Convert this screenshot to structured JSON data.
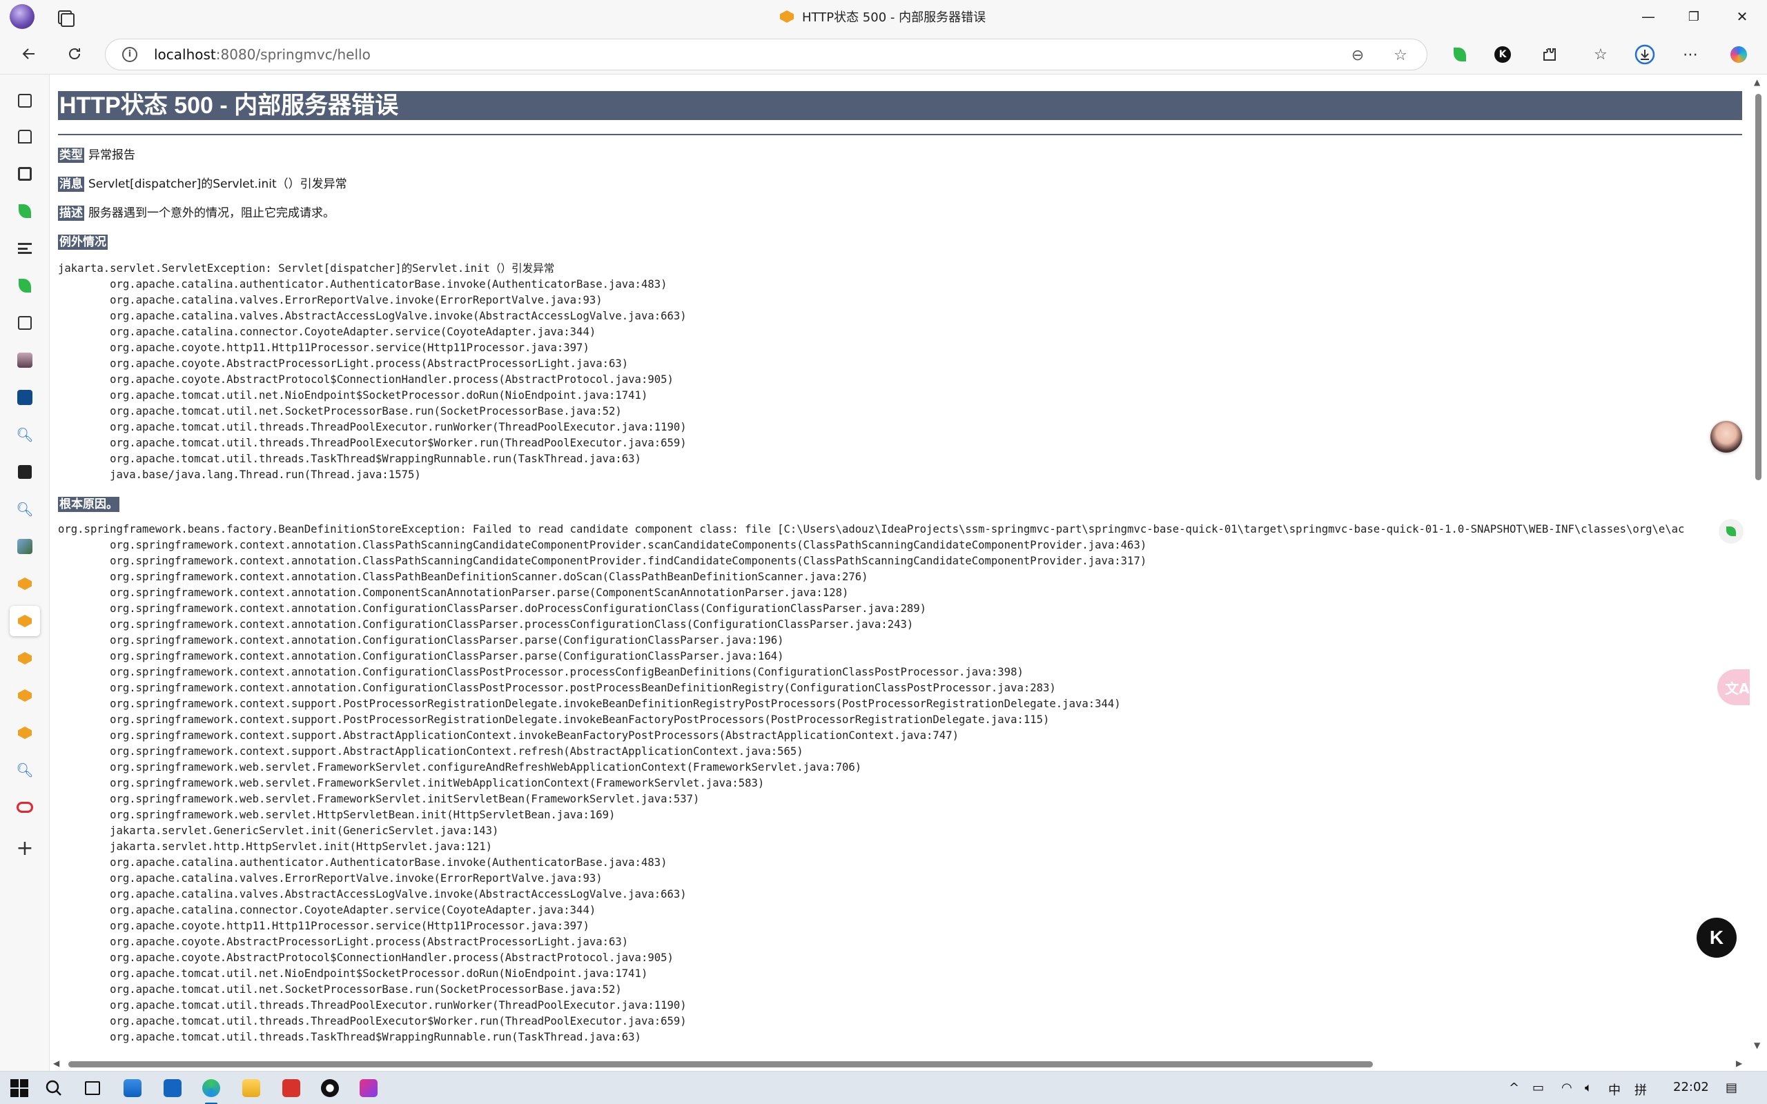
{
  "window": {
    "title": "HTTP状态 500 - 内部服务器错误",
    "minimize": "—",
    "maximize": "❐",
    "close": "✕"
  },
  "address": {
    "host": "localhost",
    "path": ":8080/springmvc/hello"
  },
  "page": {
    "heading": "HTTP状态 500 - 内部服务器错误",
    "type_label": "类型",
    "type_value": "异常报告",
    "message_label": "消息",
    "message_value": "Servlet[dispatcher]的Servlet.init（）引发异常",
    "description_label": "描述",
    "description_value": "服务器遇到一个意外的情况，阻止它完成请求。",
    "exception_label": "例外情况",
    "exception_trace": "jakarta.servlet.ServletException: Servlet[dispatcher]的Servlet.init（）引发异常\n\torg.apache.catalina.authenticator.AuthenticatorBase.invoke(AuthenticatorBase.java:483)\n\torg.apache.catalina.valves.ErrorReportValve.invoke(ErrorReportValve.java:93)\n\torg.apache.catalina.valves.AbstractAccessLogValve.invoke(AbstractAccessLogValve.java:663)\n\torg.apache.catalina.connector.CoyoteAdapter.service(CoyoteAdapter.java:344)\n\torg.apache.coyote.http11.Http11Processor.service(Http11Processor.java:397)\n\torg.apache.coyote.AbstractProcessorLight.process(AbstractProcessorLight.java:63)\n\torg.apache.coyote.AbstractProtocol$ConnectionHandler.process(AbstractProtocol.java:905)\n\torg.apache.tomcat.util.net.NioEndpoint$SocketProcessor.doRun(NioEndpoint.java:1741)\n\torg.apache.tomcat.util.net.SocketProcessorBase.run(SocketProcessorBase.java:52)\n\torg.apache.tomcat.util.threads.ThreadPoolExecutor.runWorker(ThreadPoolExecutor.java:1190)\n\torg.apache.tomcat.util.threads.ThreadPoolExecutor$Worker.run(ThreadPoolExecutor.java:659)\n\torg.apache.tomcat.util.threads.TaskThread$WrappingRunnable.run(TaskThread.java:63)\n\tjava.base/java.lang.Thread.run(Thread.java:1575)",
    "root_cause_label": "根本原因。",
    "root_cause_trace": "org.springframework.beans.factory.BeanDefinitionStoreException: Failed to read candidate component class: file [C:\\Users\\adouz\\IdeaProjects\\ssm-springmvc-part\\springmvc-base-quick-01\\target\\springmvc-base-quick-01-1.0-SNAPSHOT\\WEB-INF\\classes\\org\\e\\ac\n\torg.springframework.context.annotation.ClassPathScanningCandidateComponentProvider.scanCandidateComponents(ClassPathScanningCandidateComponentProvider.java:463)\n\torg.springframework.context.annotation.ClassPathScanningCandidateComponentProvider.findCandidateComponents(ClassPathScanningCandidateComponentProvider.java:317)\n\torg.springframework.context.annotation.ClassPathBeanDefinitionScanner.doScan(ClassPathBeanDefinitionScanner.java:276)\n\torg.springframework.context.annotation.ComponentScanAnnotationParser.parse(ComponentScanAnnotationParser.java:128)\n\torg.springframework.context.annotation.ConfigurationClassParser.doProcessConfigurationClass(ConfigurationClassParser.java:289)\n\torg.springframework.context.annotation.ConfigurationClassParser.processConfigurationClass(ConfigurationClassParser.java:243)\n\torg.springframework.context.annotation.ConfigurationClassParser.parse(ConfigurationClassParser.java:196)\n\torg.springframework.context.annotation.ConfigurationClassParser.parse(ConfigurationClassParser.java:164)\n\torg.springframework.context.annotation.ConfigurationClassPostProcessor.processConfigBeanDefinitions(ConfigurationClassPostProcessor.java:398)\n\torg.springframework.context.annotation.ConfigurationClassPostProcessor.postProcessBeanDefinitionRegistry(ConfigurationClassPostProcessor.java:283)\n\torg.springframework.context.support.PostProcessorRegistrationDelegate.invokeBeanDefinitionRegistryPostProcessors(PostProcessorRegistrationDelegate.java:344)\n\torg.springframework.context.support.PostProcessorRegistrationDelegate.invokeBeanFactoryPostProcessors(PostProcessorRegistrationDelegate.java:115)\n\torg.springframework.context.support.AbstractApplicationContext.invokeBeanFactoryPostProcessors(AbstractApplicationContext.java:747)\n\torg.springframework.context.support.AbstractApplicationContext.refresh(AbstractApplicationContext.java:565)\n\torg.springframework.web.servlet.FrameworkServlet.configureAndRefreshWebApplicationContext(FrameworkServlet.java:706)\n\torg.springframework.web.servlet.FrameworkServlet.initWebApplicationContext(FrameworkServlet.java:583)\n\torg.springframework.web.servlet.FrameworkServlet.initServletBean(FrameworkServlet.java:537)\n\torg.springframework.web.servlet.HttpServletBean.init(HttpServletBean.java:169)\n\tjakarta.servlet.GenericServlet.init(GenericServlet.java:143)\n\tjakarta.servlet.http.HttpServlet.init(HttpServlet.java:121)\n\torg.apache.catalina.authenticator.AuthenticatorBase.invoke(AuthenticatorBase.java:483)\n\torg.apache.catalina.valves.ErrorReportValve.invoke(ErrorReportValve.java:93)\n\torg.apache.catalina.valves.AbstractAccessLogValve.invoke(AbstractAccessLogValve.java:663)\n\torg.apache.catalina.connector.CoyoteAdapter.service(CoyoteAdapter.java:344)\n\torg.apache.coyote.http11.Http11Processor.service(Http11Processor.java:397)\n\torg.apache.coyote.AbstractProcessorLight.process(AbstractProcessorLight.java:63)\n\torg.apache.coyote.AbstractProtocol$ConnectionHandler.process(AbstractProtocol.java:905)\n\torg.apache.tomcat.util.net.NioEndpoint$SocketProcessor.doRun(NioEndpoint.java:1741)\n\torg.apache.tomcat.util.net.SocketProcessorBase.run(SocketProcessorBase.java:52)\n\torg.apache.tomcat.util.threads.ThreadPoolExecutor.runWorker(ThreadPoolExecutor.java:1190)\n\torg.apache.tomcat.util.threads.ThreadPoolExecutor$Worker.run(ThreadPoolExecutor.java:659)\n\torg.apache.tomcat.util.threads.TaskThread$WrappingRunnable.run(TaskThread.java:63)"
  },
  "widgets": {
    "translate": "文A",
    "k_assistant": "K"
  },
  "taskbar": {
    "ime": "中",
    "ime_mode": "拼",
    "time": "22:02"
  },
  "icons": {
    "sidebar": [
      "tab-actions-icon",
      "history-icon",
      "reading-icon",
      "leaf-extension-icon",
      "notes-icon",
      "leaf-extension-icon",
      "calendar-icon",
      "profile-image-icon",
      "code-icon",
      "search-icon",
      "terminal-icon",
      "search-icon",
      "image-icon",
      "hex-tab-icon",
      "hex-tab-icon",
      "hex-tab-icon",
      "hex-tab-icon",
      "hex-tab-icon",
      "search-icon",
      "pill-icon",
      "add-icon"
    ]
  },
  "colors": {
    "tomcat_header": "#525d76",
    "accent_blue": "#0067c0"
  }
}
